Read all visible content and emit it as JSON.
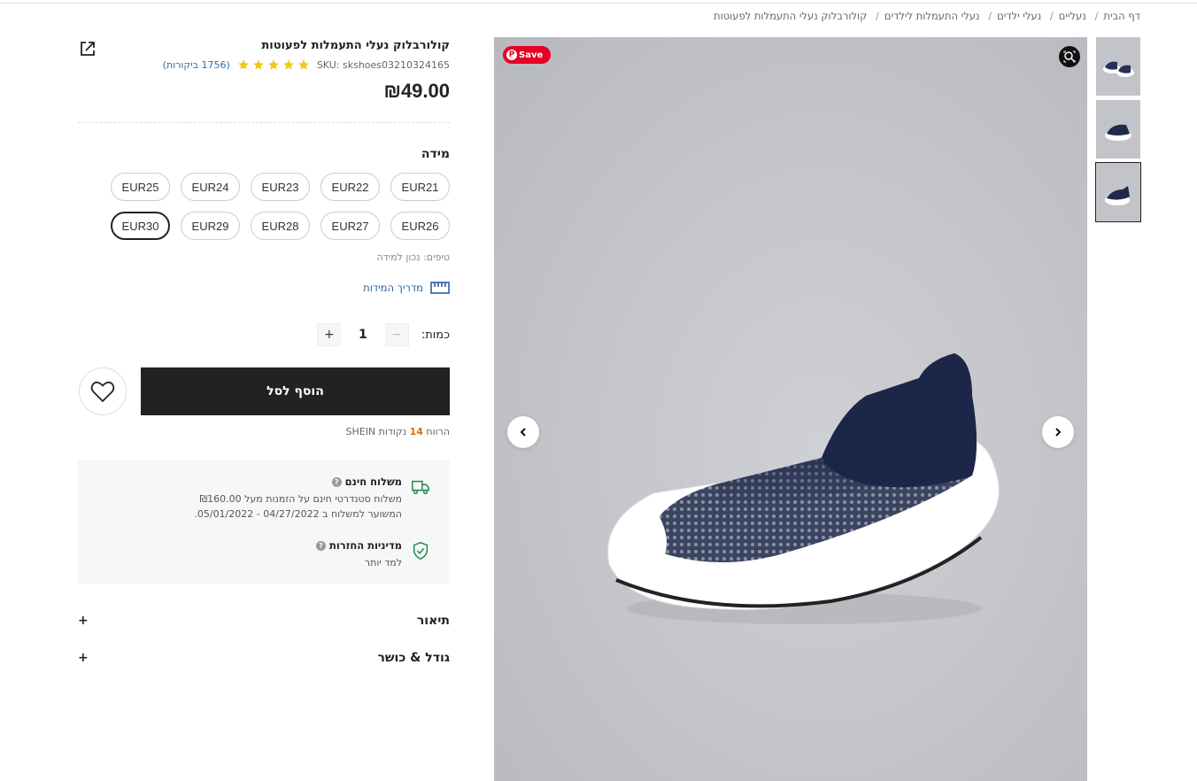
{
  "breadcrumb": [
    "דף הבית",
    "נעליים",
    "נעלי ילדים",
    "נעלי התעמלות לילדים",
    "קולורבלוק נעלי התעמלות לפעוטות"
  ],
  "gallery": {
    "save_label": "Save",
    "thumbnail_count": 3,
    "active_thumbnail": 3
  },
  "product": {
    "title": "קולורבלוק נעלי התעמלות לפעוטות",
    "sku": "SKU: skshoes03210324165",
    "rating": 5,
    "reviews": "(1756 ביקורות)",
    "price": "₪49.00"
  },
  "size": {
    "title": "מידה",
    "options": [
      "EUR21",
      "EUR22",
      "EUR23",
      "EUR24",
      "EUR25",
      "EUR26",
      "EUR27",
      "EUR28",
      "EUR29",
      "EUR30"
    ],
    "selected": "EUR30",
    "tips": "טיפים: נכון למידה",
    "guide_label": "מדריך המידות"
  },
  "quantity": {
    "label": "כמות:",
    "value": "1",
    "minus": "−",
    "plus": "+"
  },
  "cart": {
    "add_label": "הוסף לסל"
  },
  "points": {
    "prefix": "הרווח ",
    "value": "14",
    "suffix": " נקודות SHEIN"
  },
  "shipping": {
    "title": "משלוח חינם",
    "line1": "משלוח סטנדרטי חינם על הזמנות מעל ₪160.00",
    "line2": "המשוער למשלוח ב 04/27/2022 - 05/01/2022."
  },
  "returns": {
    "title": "מדיניות החזרות",
    "link": "למד יותר"
  },
  "accordions": {
    "description": "תיאור",
    "size_fit": "גודל & כושר",
    "expand": "+"
  },
  "colors": {
    "accent_link": "#2b6cb0",
    "star": "#f5c518",
    "cart_bg": "#222222",
    "points": "#e06d00",
    "save_badge": "#e60023",
    "shipping_icon": "#1a8a4a"
  }
}
